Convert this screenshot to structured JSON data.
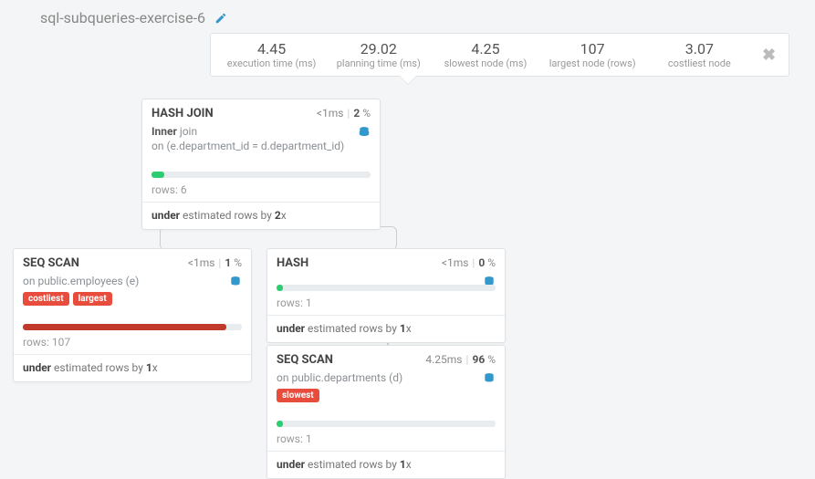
{
  "header": {
    "title": "sql-subqueries-exercise-6",
    "stats": {
      "exec_val": "4.45",
      "exec_lbl": "execution time (ms)",
      "plan_val": "29.02",
      "plan_lbl": "planning time (ms)",
      "slow_val": "4.25",
      "slow_lbl": "slowest node (ms)",
      "large_val": "107",
      "large_lbl": "largest node (rows)",
      "cost_val": "3.07",
      "cost_lbl": "costliest node"
    }
  },
  "nodes": {
    "hashjoin": {
      "title": "HASH JOIN",
      "time": "<1ms",
      "pct": "2",
      "pct_suffix": " %",
      "inner_lbl": "Inner",
      "join_lbl": " join",
      "on_lbl": "on ",
      "on_cond": "(e.department_id = d.department_id)",
      "rows_lbl": "rows: ",
      "rows": "6",
      "foot_pre": "under",
      "foot_mid": " estimated rows by ",
      "foot_val": "2",
      "foot_suf": "x"
    },
    "seqscan1": {
      "title": "SEQ SCAN",
      "time": "<1ms",
      "pct": "1",
      "pct_suffix": " %",
      "on_lbl": "on ",
      "on_tbl": "public.employees (e)",
      "tag_cost": "costliest",
      "tag_large": "largest",
      "rows_lbl": "rows: ",
      "rows": "107",
      "foot_pre": "under",
      "foot_mid": " estimated rows by ",
      "foot_val": "1",
      "foot_suf": "x"
    },
    "hash": {
      "title": "HASH",
      "time": "<1ms",
      "pct": "0",
      "pct_suffix": " %",
      "rows_lbl": "rows: ",
      "rows": "1",
      "foot_pre": "under",
      "foot_mid": " estimated rows by ",
      "foot_val": "1",
      "foot_suf": "x"
    },
    "seqscan2": {
      "title": "SEQ SCAN",
      "time": "4.25ms",
      "pct": "96",
      "pct_suffix": " %",
      "on_lbl": "on ",
      "on_tbl": "public.departments (d)",
      "tag_slow": "slowest",
      "rows_lbl": "rows: ",
      "rows": "1",
      "foot_pre": "under",
      "foot_mid": " estimated rows by ",
      "foot_val": "1",
      "foot_suf": "x"
    }
  }
}
